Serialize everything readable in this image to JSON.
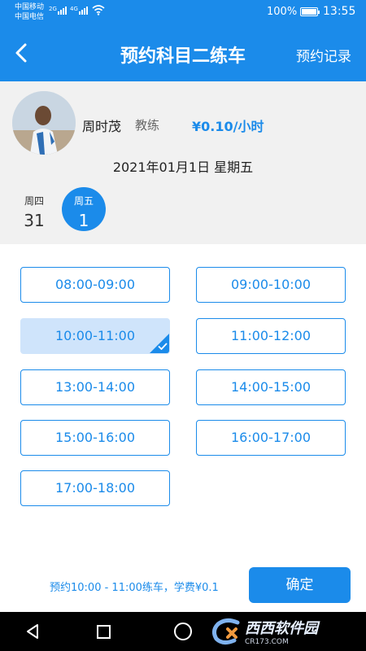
{
  "status_bar": {
    "carrier1": "中国移动",
    "carrier2": "中国电信",
    "net1": "2G",
    "net2": "4G",
    "battery": "100%",
    "time": "13:55"
  },
  "nav": {
    "title": "预约科目二练车",
    "records_label": "预约记录",
    "back_icon": "chevron-left-icon"
  },
  "coach": {
    "name": "周时茂",
    "role": "教练",
    "price": "¥0.10/小时"
  },
  "date": {
    "full": "2021年01月1日 星期五",
    "days": [
      {
        "weekday": "周四",
        "day": "31"
      },
      {
        "weekday": "周五",
        "day": "1"
      }
    ]
  },
  "slots": [
    {
      "label": "08:00-09:00",
      "selected": false
    },
    {
      "label": "09:00-10:00",
      "selected": false
    },
    {
      "label": "10:00-11:00",
      "selected": true
    },
    {
      "label": "11:00-12:00",
      "selected": false
    },
    {
      "label": "13:00-14:00",
      "selected": false
    },
    {
      "label": "14:00-15:00",
      "selected": false
    },
    {
      "label": "15:00-16:00",
      "selected": false
    },
    {
      "label": "16:00-17:00",
      "selected": false
    },
    {
      "label": "17:00-18:00",
      "selected": false
    }
  ],
  "footer": {
    "summary": "预约10:00 - 11:00练车，学费¥0.1",
    "confirm_label": "确定"
  },
  "watermark": {
    "text": "西西软件园",
    "sub": "CR173.COM"
  },
  "colors": {
    "accent": "#1b8bea",
    "selected_bg": "#cfe4fb",
    "panel_bg": "#f1f1f1"
  }
}
